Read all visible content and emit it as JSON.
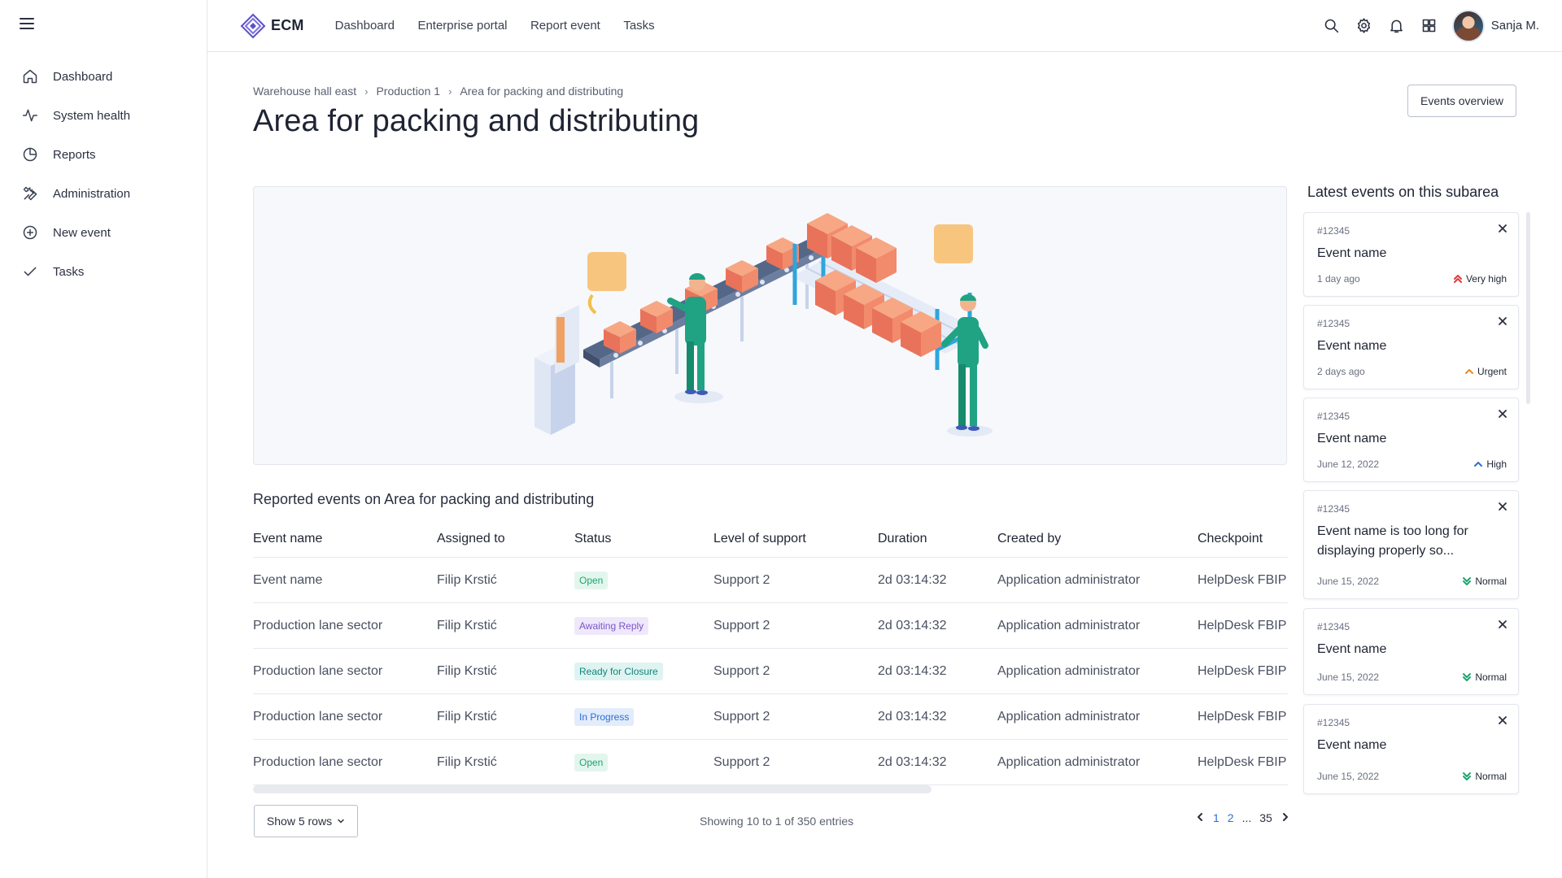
{
  "app": {
    "name": "ECM",
    "user": "Sanja M."
  },
  "top_nav": [
    {
      "label": "Dashboard"
    },
    {
      "label": "Enterprise portal"
    },
    {
      "label": "Report event"
    },
    {
      "label": "Tasks"
    }
  ],
  "top_icons": [
    "search-icon",
    "gear-icon",
    "bell-icon",
    "grid-icon"
  ],
  "sidebar": {
    "items": [
      {
        "label": "Dashboard",
        "icon": "home-icon"
      },
      {
        "label": "System health",
        "icon": "pulse-icon"
      },
      {
        "label": "Reports",
        "icon": "pie-chart-icon"
      },
      {
        "label": "Administration",
        "icon": "wrench-icon"
      },
      {
        "label": "New event",
        "icon": "plus-circle-icon"
      },
      {
        "label": "Tasks",
        "icon": "check-icon"
      }
    ]
  },
  "breadcrumb": [
    "Warehouse hall east",
    "Production 1",
    "Area for packing and distributing"
  ],
  "page_title": "Area for packing and distributing",
  "events_overview_label": "Events overview",
  "table": {
    "caption": "Reported events on Area for packing and distributing",
    "columns": [
      "Event name",
      "Assigned to",
      "Status",
      "Level of support",
      "Duration",
      "Created by",
      "Checkpoint"
    ],
    "rows": [
      {
        "name": "Event name",
        "assigned": "Filip Krstić",
        "status": "Open",
        "support": "Support 2",
        "duration": "2d 03:14:32",
        "created_by": "Application administrator",
        "checkpoint": "HelpDesk FBIP"
      },
      {
        "name": "Production lane sector",
        "assigned": "Filip Krstić",
        "status": "Awaiting Reply",
        "support": "Support 2",
        "duration": "2d 03:14:32",
        "created_by": "Application administrator",
        "checkpoint": "HelpDesk FBIP"
      },
      {
        "name": "Production lane sector",
        "assigned": "Filip Krstić",
        "status": "Ready for Closure",
        "support": "Support 2",
        "duration": "2d 03:14:32",
        "created_by": "Application administrator",
        "checkpoint": "HelpDesk FBIP"
      },
      {
        "name": "Production lane sector",
        "assigned": "Filip Krstić",
        "status": "In Progress",
        "support": "Support 2",
        "duration": "2d 03:14:32",
        "created_by": "Application administrator",
        "checkpoint": "HelpDesk FBIP"
      },
      {
        "name": "Production lane sector",
        "assigned": "Filip Krstić",
        "status": "Open",
        "support": "Support 2",
        "duration": "2d 03:14:32",
        "created_by": "Application administrator",
        "checkpoint": "HelpDesk FBIP"
      }
    ],
    "status_colors": {
      "Open": "#1ea56f",
      "Awaiting Reply": "#7b55c9",
      "Ready for Closure": "#11857a",
      "In Progress": "#2d6fd1"
    }
  },
  "footer": {
    "rows_select_label": "Show 5 rows",
    "showing_text": "Showing 10 to 1 of 350 entries",
    "pages": [
      "1",
      "2",
      "...",
      "35"
    ]
  },
  "panel": {
    "title": "Latest events on this subarea",
    "events": [
      {
        "id": "#12345",
        "name": "Event name",
        "date": "1 day ago",
        "priority": "Very high",
        "priority_color": "#e03a3a"
      },
      {
        "id": "#12345",
        "name": "Event name",
        "date": "2 days ago",
        "priority": "Urgent",
        "priority_color": "#f08a1c"
      },
      {
        "id": "#12345",
        "name": "Event name",
        "date": "June 12, 2022",
        "priority": "High",
        "priority_color": "#2d6fd1"
      },
      {
        "id": "#12345",
        "name": "Event name is too long for displaying properly so...",
        "date": "June 15, 2022",
        "priority": "Normal",
        "priority_color": "#1ea56f"
      },
      {
        "id": "#12345",
        "name": "Event name",
        "date": "June 15, 2022",
        "priority": "Normal",
        "priority_color": "#1ea56f"
      },
      {
        "id": "#12345",
        "name": "Event name",
        "date": "June 15, 2022",
        "priority": "Normal",
        "priority_color": "#1ea56f"
      }
    ]
  },
  "colors": {
    "accent": "#2d6fd1",
    "brand": "#5b4fc9"
  }
}
